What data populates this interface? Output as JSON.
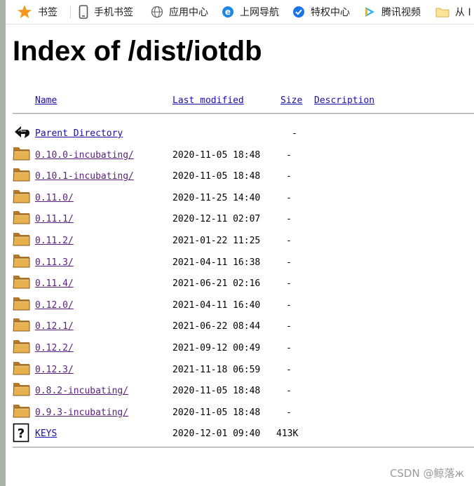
{
  "bookmarks": [
    {
      "label": "书签",
      "icon": "star-icon"
    },
    {
      "label": "手机书签",
      "icon": "phone-icon"
    },
    {
      "label": "应用中心",
      "icon": "globe-icon"
    },
    {
      "label": "上网导航",
      "icon": "ie-icon"
    },
    {
      "label": "特权中心",
      "icon": "privilege-icon"
    },
    {
      "label": "腾讯视频",
      "icon": "video-icon"
    },
    {
      "label": "从 I",
      "icon": "folder-icon"
    }
  ],
  "page": {
    "title": "Index of /dist/iotdb",
    "headers": {
      "name": "Name",
      "modified": "Last modified",
      "size": "Size",
      "description": "Description"
    },
    "entries": [
      {
        "name": "Parent Directory",
        "modified": "",
        "size": "-",
        "icon": "back-icon"
      },
      {
        "name": "0.10.0-incubating/",
        "modified": "2020-11-05 18:48",
        "size": "-",
        "icon": "folder-icon",
        "visited": true
      },
      {
        "name": "0.10.1-incubating/",
        "modified": "2020-11-05 18:48",
        "size": "-",
        "icon": "folder-icon",
        "visited": true
      },
      {
        "name": "0.11.0/",
        "modified": "2020-11-25 14:40",
        "size": "-",
        "icon": "folder-icon",
        "visited": true
      },
      {
        "name": "0.11.1/",
        "modified": "2020-12-11 02:07",
        "size": "-",
        "icon": "folder-icon",
        "visited": true
      },
      {
        "name": "0.11.2/",
        "modified": "2021-01-22 11:25",
        "size": "-",
        "icon": "folder-icon",
        "visited": true
      },
      {
        "name": "0.11.3/",
        "modified": "2021-04-11 16:38",
        "size": "-",
        "icon": "folder-icon",
        "visited": true
      },
      {
        "name": "0.11.4/",
        "modified": "2021-06-21 02:16",
        "size": "-",
        "icon": "folder-icon",
        "visited": true
      },
      {
        "name": "0.12.0/",
        "modified": "2021-04-11 16:40",
        "size": "-",
        "icon": "folder-icon",
        "visited": true
      },
      {
        "name": "0.12.1/",
        "modified": "2021-06-22 08:44",
        "size": "-",
        "icon": "folder-icon",
        "visited": true
      },
      {
        "name": "0.12.2/",
        "modified": "2021-09-12 00:49",
        "size": "-",
        "icon": "folder-icon",
        "visited": true
      },
      {
        "name": "0.12.3/",
        "modified": "2021-11-18 06:59",
        "size": "-",
        "icon": "folder-icon",
        "visited": true
      },
      {
        "name": "0.8.2-incubating/",
        "modified": "2020-11-05 18:48",
        "size": "-",
        "icon": "folder-icon",
        "visited": true
      },
      {
        "name": "0.9.3-incubating/",
        "modified": "2020-11-05 18:48",
        "size": "-",
        "icon": "folder-icon",
        "visited": true
      },
      {
        "name": "KEYS",
        "modified": "2020-12-01 09:40",
        "size": "413K",
        "icon": "unknown-file-icon",
        "visited": false
      }
    ]
  },
  "watermark": "CSDN @鲸落ж",
  "colors": {
    "link": "#1a0dab",
    "visited_link": "#5a1e7e",
    "folder": "#e8b14f"
  }
}
